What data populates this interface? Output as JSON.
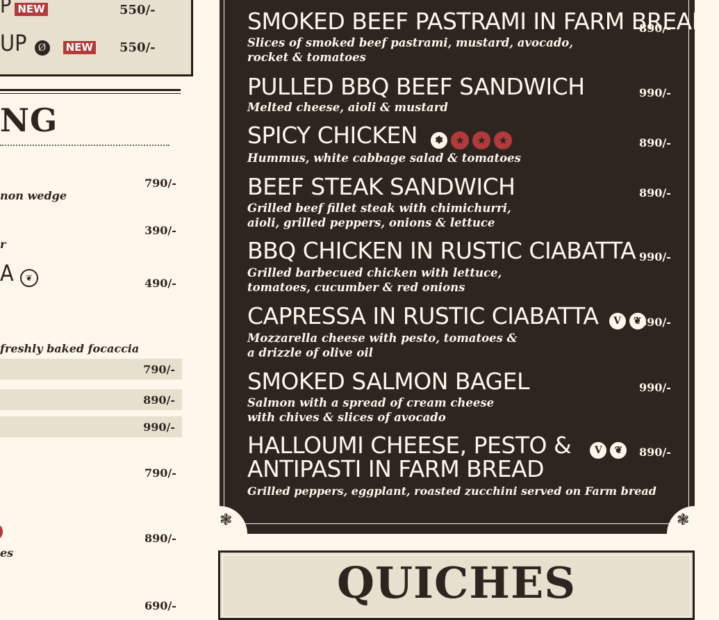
{
  "left": {
    "soup_items": [
      {
        "name": "P",
        "badge": "NEW",
        "price": "550/-"
      },
      {
        "name": "UP",
        "badge": "NEW",
        "price": "550/-"
      }
    ],
    "section_title": "NG",
    "items": [
      {
        "desc": "non wedge",
        "price": "790/-"
      },
      {
        "desc": "r",
        "price": "390/-"
      },
      {
        "name": "A",
        "price": "490/-"
      },
      {
        "desc": "freshly baked focaccia"
      }
    ],
    "band_prices": [
      "790/-",
      "890/-",
      "990/-"
    ],
    "more_prices": [
      "790/-",
      "890/-",
      "690/-"
    ],
    "tail_desc": "es"
  },
  "right": {
    "items": [
      {
        "name": "SMOKED BEEF PASTRAMI IN FARM BREAD",
        "desc1": "Slices of smoked beef pastrami, mustard, avocado,",
        "desc2": "rocket & tomatoes",
        "price": "890/-"
      },
      {
        "name": "PULLED BBQ BEEF SANDWICH",
        "desc1": "Melted cheese, aioli & mustard",
        "price": "990/-"
      },
      {
        "name": "SPICY CHICKEN",
        "desc1": "Hummus, white cabbage salad & tomatoes",
        "price": "890/-"
      },
      {
        "name": "BEEF STEAK SANDWICH",
        "desc1": "Grilled beef fillet steak with chimichurri,",
        "desc2": "aioli, grilled peppers, onions & lettuce",
        "price": "890/-"
      },
      {
        "name": "BBQ CHICKEN IN RUSTIC CIABATTA",
        "desc1": "Grilled barbecued chicken with lettuce,",
        "desc2": "tomatoes, cucumber & red onions",
        "price": "990/-"
      },
      {
        "name": "CAPRESSA IN RUSTIC CIABATTA",
        "desc1": "Mozzarella cheese with pesto, tomatoes &",
        "desc2": "a drizzle of olive oil",
        "price": "890/-"
      },
      {
        "name": "SMOKED SALMON BAGEL",
        "desc1": "Salmon with a spread of cream cheese",
        "desc2": "with chives & slices of avocado",
        "price": "990/-"
      },
      {
        "name1": "HALLOUMI CHEESE, PESTO &",
        "name2": "ANTIPASTI IN FARM BREAD",
        "desc1": "Grilled peppers, eggplant, roasted zucchini served on Farm bread",
        "price": "890/-"
      }
    ]
  },
  "quiches": {
    "title": "QUICHES"
  },
  "colors": {
    "dark": "#2d2620",
    "cream": "#fdf7ec",
    "beige": "#e8e0cf",
    "red": "#b23a3a"
  },
  "icons": [
    "vegetarian-icon",
    "vegan-icon",
    "spicy-star-icon",
    "gluten-free-icon",
    "nut-icon",
    "flower-ornament-icon"
  ]
}
